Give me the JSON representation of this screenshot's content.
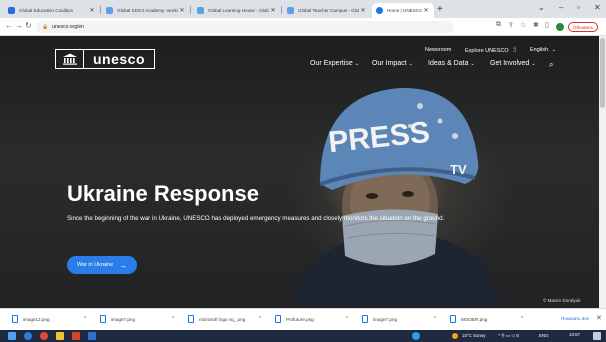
{
  "browser": {
    "tabs": [
      {
        "title": "Global Education Coalition",
        "active": false,
        "favicon_color": "#2c6fd9"
      },
      {
        "title": "Global SDG4 Academy -working",
        "active": false,
        "favicon_color": "#5aa2e8"
      },
      {
        "title": "Global Learning House - Global",
        "active": false,
        "favicon_color": "#5aa2e8"
      },
      {
        "title": "Global Teacher Campus - Global",
        "active": false,
        "favicon_color": "#5aa2e8"
      },
      {
        "title": "Home | UNESCO",
        "active": true,
        "favicon_color": "#1a73e8"
      }
    ],
    "url": "unesco.org/en",
    "update_label": "Обновить"
  },
  "site": {
    "logo_text": "unesco",
    "utility_nav": {
      "newsroom": "Newsroom",
      "explore": "Explore UNESCO",
      "language": "English"
    },
    "main_nav": [
      "Our Expertise",
      "Our Impact",
      "Ideas & Data",
      "Get Involved"
    ]
  },
  "hero": {
    "helmet_text": "PRESS",
    "helmet_tv": "TV",
    "title": "Ukraine Response",
    "subtitle": "Since the beginning of the war in Ukraine, UNESCO has deployed emergency measures and closely monitors the situation on the ground.",
    "cta_label": "War in Ukraine",
    "credit": "© Maxim Dondyuk"
  },
  "downloads": {
    "items": [
      "image12.png",
      "image7.png",
      "microsoft logo vq_.png",
      "Profuture.png",
      "image7.png",
      "MOOER.png"
    ],
    "show_all": "Показать все"
  },
  "taskbar": {
    "weather": "10°C Sunny",
    "lang": "ENG",
    "time": "10:57"
  },
  "colors": {
    "accent": "#2b7de9",
    "update": "#d93025"
  }
}
